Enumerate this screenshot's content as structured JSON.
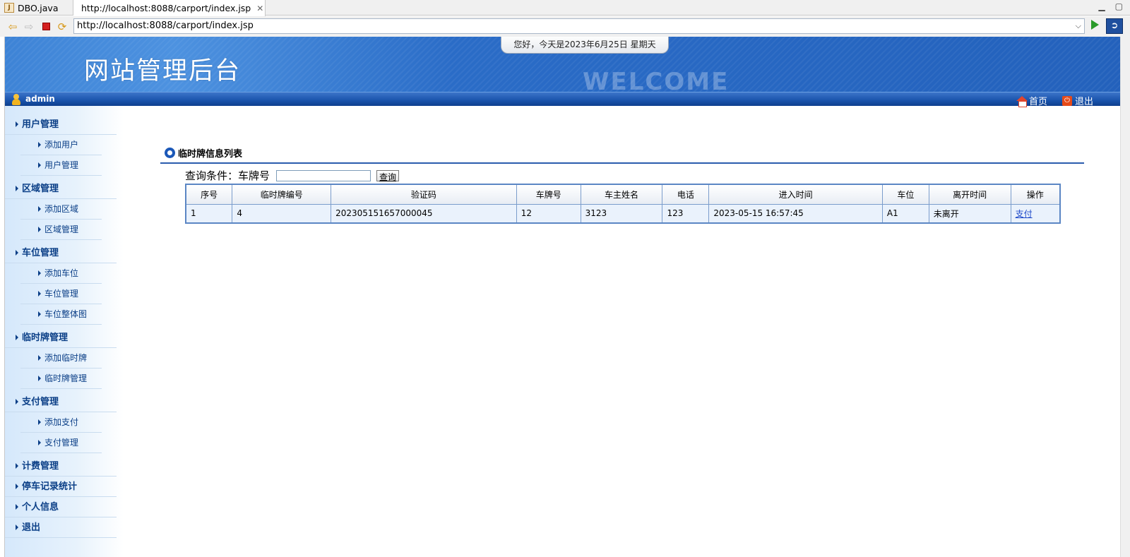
{
  "ide": {
    "tabs": [
      {
        "label": "DBO.java"
      },
      {
        "label": "http://localhost:8088/carport/index.jsp"
      }
    ],
    "url": "http://localhost:8088/carport/index.jsp"
  },
  "header": {
    "site_title": "网站管理后台",
    "greeting": "您好，今天是2023年6月25日 星期天",
    "welcome_text": "WELCOME",
    "username": "admin",
    "home_label": "首页",
    "logout_label": "退出"
  },
  "sidebar": {
    "categories": [
      {
        "label": "用户管理",
        "items": [
          "添加用户",
          "用户管理"
        ]
      },
      {
        "label": "区域管理",
        "items": [
          "添加区域",
          "区域管理"
        ]
      },
      {
        "label": "车位管理",
        "items": [
          "添加车位",
          "车位管理",
          "车位整体图"
        ]
      },
      {
        "label": "临时牌管理",
        "items": [
          "添加临时牌",
          "临时牌管理"
        ]
      },
      {
        "label": "支付管理",
        "items": [
          "添加支付",
          "支付管理"
        ]
      },
      {
        "label": "计费管理",
        "items": []
      },
      {
        "label": "停车记录统计",
        "items": []
      },
      {
        "label": "个人信息",
        "items": []
      },
      {
        "label": "退出",
        "items": []
      }
    ]
  },
  "main": {
    "section_title": "临时牌信息列表",
    "query_label": "查询条件：车牌号",
    "query_value": "",
    "query_button": "查询",
    "table": {
      "columns": [
        "序号",
        "临时牌编号",
        "验证码",
        "车牌号",
        "车主姓名",
        "电话",
        "进入时间",
        "车位",
        "离开时间",
        "操作"
      ],
      "rows": [
        [
          "1",
          "4",
          "202305151657000045",
          "12",
          "3123",
          "123",
          "2023-05-15 16:57:45",
          "A1",
          "未离开",
          "支付"
        ]
      ]
    }
  }
}
